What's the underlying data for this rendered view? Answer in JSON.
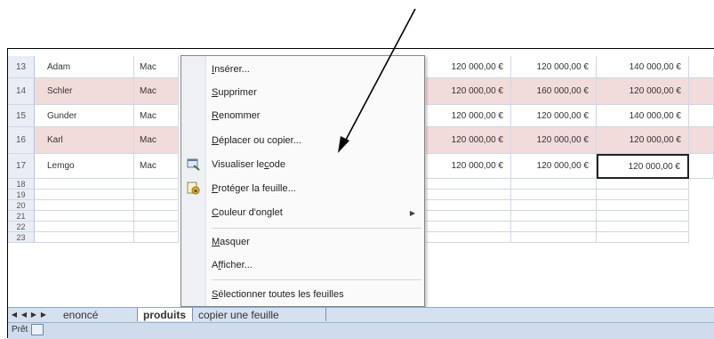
{
  "rows": [
    {
      "num": "13",
      "name": "Adam",
      "type": "Mac",
      "values": [
        "120 000,00 €",
        "120 000,00 €",
        "140 000,00 €"
      ],
      "pink": false
    },
    {
      "num": "14",
      "name": "Schler",
      "type": "Mac",
      "values": [
        "120 000,00 €",
        "160 000,00 €",
        "120 000,00 €"
      ],
      "pink": true
    },
    {
      "num": "15",
      "name": "Gunder",
      "type": "Mac",
      "values": [
        "120 000,00 €",
        "120 000,00 €",
        "140 000,00 €"
      ],
      "pink": false
    },
    {
      "num": "16",
      "name": "Karl",
      "type": "Mac",
      "values": [
        "120 000,00 €",
        "120 000,00 €",
        "120 000,00 €"
      ],
      "pink": true
    },
    {
      "num": "17",
      "name": "Lemgo",
      "type": "Mac",
      "values": [
        "120 000,00 €",
        "120 000,00 €",
        "120 000,00 €"
      ],
      "pink": false
    }
  ],
  "empty_rows": [
    "18",
    "19",
    "20",
    "21",
    "22",
    "23"
  ],
  "context_menu": {
    "insert": {
      "key": "I",
      "rest": "nsérer..."
    },
    "delete": {
      "key": "S",
      "rest": "upprimer"
    },
    "rename": {
      "key": "R",
      "rest": "enommer"
    },
    "move_copy": {
      "key": "D",
      "rest": "éplacer ou copier..."
    },
    "view_code": {
      "pre": "Visualiser le ",
      "key": "c",
      "rest": "ode"
    },
    "protect": {
      "key": "P",
      "rest": "rotéger la feuille..."
    },
    "tab_color": {
      "key": "C",
      "rest": "ouleur d'onglet"
    },
    "hide": {
      "key": "M",
      "rest": "asquer"
    },
    "unhide": {
      "pre": "A",
      "key": "f",
      "rest": "ficher..."
    },
    "select_all": {
      "key": "S",
      "rest": "électionner toutes les feuilles"
    }
  },
  "sheet_tabs": [
    "enoncé",
    "produits",
    "copier une feuille"
  ],
  "status": {
    "ready": "Prêt"
  },
  "colors": {
    "row_highlight": "#f2dcdb",
    "menu_bg": "#fafafa",
    "tabbar": "#d6e1f0"
  }
}
